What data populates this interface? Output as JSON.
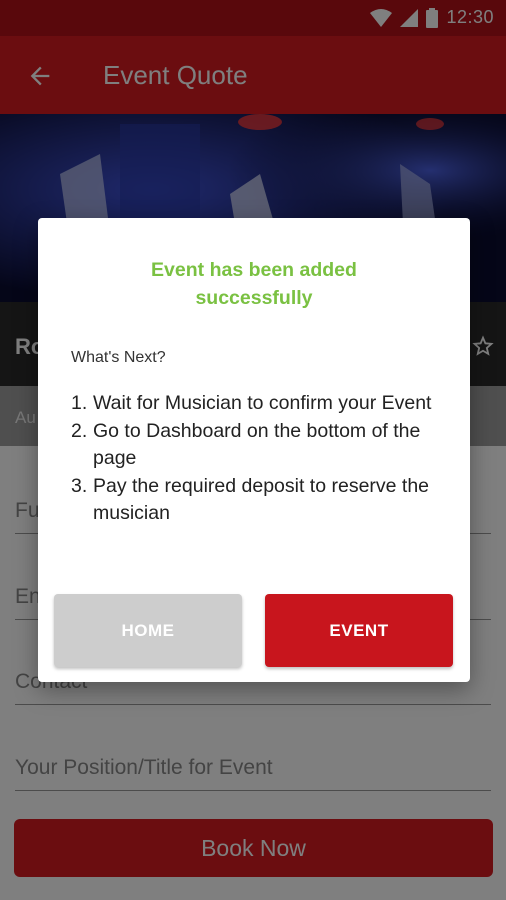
{
  "status_bar": {
    "time": "12:30"
  },
  "app_bar": {
    "title": "Event Quote"
  },
  "artist": {
    "name_partial": "Ro",
    "subtitle_partial": "Au"
  },
  "form": {
    "fields": [
      "Fu",
      "En",
      "Contact",
      "Your Position/Title for Event"
    ],
    "submit_label": "Book Now"
  },
  "dialog": {
    "title": "Event has been added successfully",
    "whats_next": "What's Next?",
    "steps": [
      "Wait for Musician to confirm your Event",
      "Go to Dashboard on the bottom of the page",
      "Pay the required deposit to reserve the musician"
    ],
    "home_label": "HOME",
    "event_label": "EVENT"
  },
  "colors": {
    "primary": "#d71a20",
    "success": "#7ac142",
    "secondary_button": "#cdcdcd"
  }
}
